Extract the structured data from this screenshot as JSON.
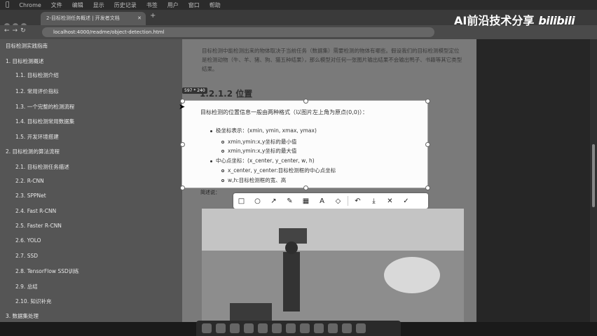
{
  "menubar": {
    "app": "Chrome",
    "items": [
      "文件",
      "编辑",
      "显示",
      "历史记录",
      "书签",
      "用户",
      "窗口",
      "帮助"
    ]
  },
  "browser": {
    "tab_title": "2-目标检测任务概述 | 开发者文档",
    "url": "localhost:4000/readme/object-detection.html"
  },
  "watermark": {
    "text": "AI前沿技术分享",
    "logo": "bilibili"
  },
  "sidebar": {
    "items": [
      "目标检测实践指南",
      "1. 目标检测概述",
      "1.1. 目标检测介绍",
      "1.2. 常用评价指标",
      "1.3. 一个完整的检测流程",
      "1.4. 目标检测常用数据集",
      "1.5. 开发环境搭建",
      "2. 目标检测的算法流程",
      "2.1. 目标检测任务描述",
      "2.2. R-CNN",
      "2.3. SPPNet",
      "2.4. Fast R-CNN",
      "2.5. Faster R-CNN",
      "2.6. YOLO",
      "2.7. SSD",
      "2.8. TensorFlow SSD训练",
      "2.9. 总结",
      "2.10. 知识补充",
      "3. 数据集处理"
    ]
  },
  "article": {
    "paragraph": "目标检测中能检测出来的物体取决于当前任务（数据集）需要检测的物体有哪些。假设我们的目标检测模型定位是检测动物（牛、羊、猪、狗、猫五种结果），那么模型对任何一张图片输出结果不会输出鸭子、书籍等其它类型结果。",
    "section_title": "1.2.1.2 位置",
    "size_badge": "597 * 240",
    "below_text": "简述说："
  },
  "selection": {
    "title": "目标检测的位置信息一般由两种格式（以图片左上角为原点(0,0)）：",
    "lines": [
      "极坐标表示：(xmin, ymin, xmax, ymax)",
      "xmin,ymin:x,y坐标的最小值",
      "xmin,ymin:x,y坐标的最大值",
      "中心点坐标：(x_center, y_center, w, h)",
      "x_center, y_center:目标检测框的中心点坐标",
      "w,h:目标检测框的宽、高"
    ]
  },
  "snap_toolbar": {
    "tools": [
      "rectangle-tool",
      "ellipse-tool",
      "arrow-tool",
      "pencil-tool",
      "mosaic-tool",
      "text-tool",
      "marker-tool",
      "undo",
      "save",
      "cancel",
      "confirm"
    ],
    "glyphs": [
      "□",
      "○",
      "↗",
      "✎",
      "▦",
      "A",
      "◇",
      "↶",
      "⤓",
      "✕",
      "✓"
    ]
  }
}
